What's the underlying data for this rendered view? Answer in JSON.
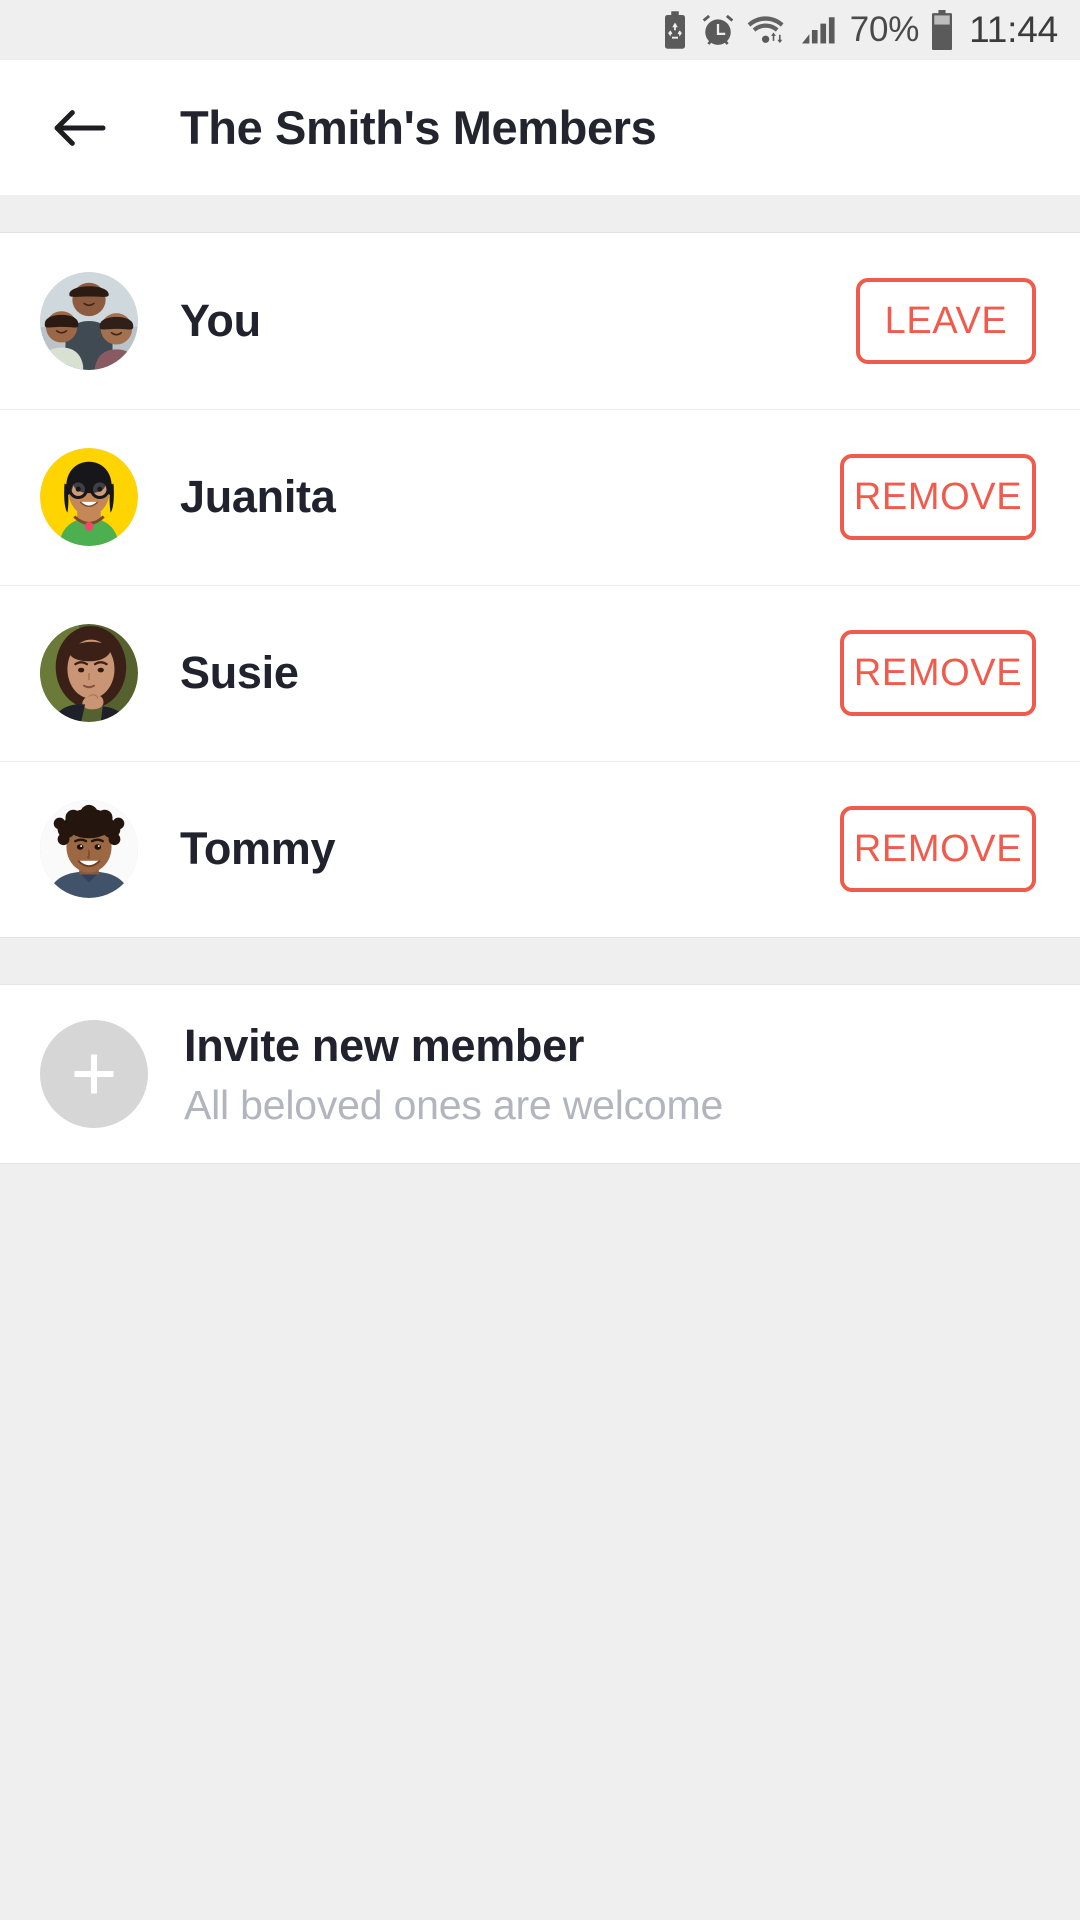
{
  "status_bar": {
    "icons": [
      {
        "name": "power-saving-battery-icon",
        "label": "power saving"
      },
      {
        "name": "alarm-clock-icon",
        "label": "alarm"
      },
      {
        "name": "wifi-icon",
        "label": "wifi"
      },
      {
        "name": "cellular-signal-icon",
        "label": "signal"
      }
    ],
    "battery_percent": "70%",
    "battery_icon": "battery-icon",
    "time": "11:44"
  },
  "app_bar": {
    "back_icon": "back-arrow-icon",
    "title": "The Smith's Members"
  },
  "members": [
    {
      "name": "You",
      "avatar": "family-photo-avatar",
      "action_label": "LEAVE",
      "action_type": "leave"
    },
    {
      "name": "Juanita",
      "avatar": "illustrated-woman-glasses-avatar",
      "action_label": "REMOVE",
      "action_type": "remove"
    },
    {
      "name": "Susie",
      "avatar": "young-woman-photo-avatar",
      "action_label": "REMOVE",
      "action_type": "remove"
    },
    {
      "name": "Tommy",
      "avatar": "young-boy-photo-avatar",
      "action_label": "REMOVE",
      "action_type": "remove"
    }
  ],
  "invite": {
    "icon": "plus-icon",
    "title": "Invite new member",
    "subtitle": "All beloved ones are welcome"
  },
  "colors": {
    "accent": "#EF5B4C",
    "text_primary": "#22222E",
    "text_muted": "#B2B4BE",
    "background": "#EFEFEF",
    "surface": "#FFFFFF"
  }
}
